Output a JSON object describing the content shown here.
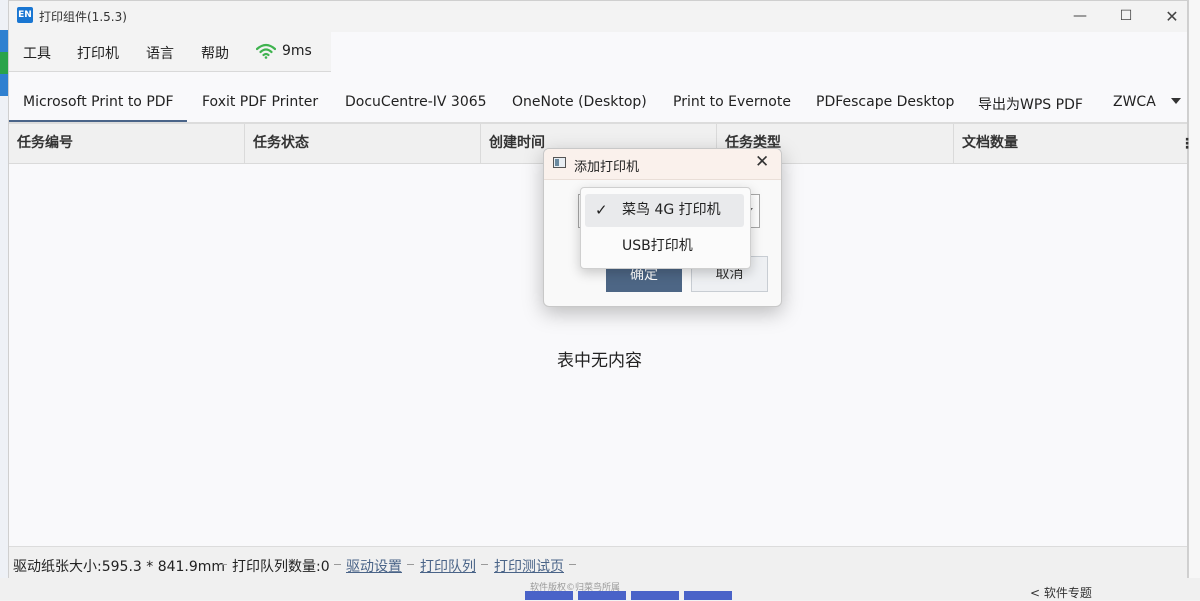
{
  "window": {
    "title": "打印组件(1.5.3)",
    "app_icon_text": "EN",
    "controls": {
      "minimize": "—",
      "maximize": "☐",
      "close": "✕"
    }
  },
  "menu": {
    "items": [
      "工具",
      "打印机",
      "语言",
      "帮助"
    ],
    "latency": "9ms",
    "wifi_color": "#3fb34f"
  },
  "printer_tabs": {
    "items": [
      "Microsoft Print to PDF",
      "Foxit PDF Printer",
      "DocuCentre-IV 3065",
      "OneNote (Desktop)",
      "Print to Evernote",
      "PDFescape Desktop",
      "导出为WPS PDF",
      "ZWCA"
    ],
    "active_index": 0,
    "accent": "#4a6488"
  },
  "table": {
    "columns": [
      "任务编号",
      "任务状态",
      "创建时间",
      "任务类型",
      "文档数量"
    ],
    "empty_text": "表中无内容",
    "menu_glyph": "⋮"
  },
  "status_bar": {
    "paper_size": "驱动纸张大小:595.3 * 841.9mm",
    "queue_count": "打印队列数量:0",
    "links": [
      "驱动设置",
      "打印队列",
      "打印测试页"
    ]
  },
  "dialog": {
    "title": "添加打印机",
    "close": "✕",
    "ok_label": "确定",
    "cancel_label": "取消",
    "options": [
      {
        "label": "菜鸟 4G 打印机",
        "selected": true
      },
      {
        "label": "USB打印机",
        "selected": false
      }
    ],
    "check_glyph": "✓"
  },
  "background": {
    "watermark": "软件版权©归菜鸟所属",
    "right_bottom_text": "<   软件专题"
  }
}
